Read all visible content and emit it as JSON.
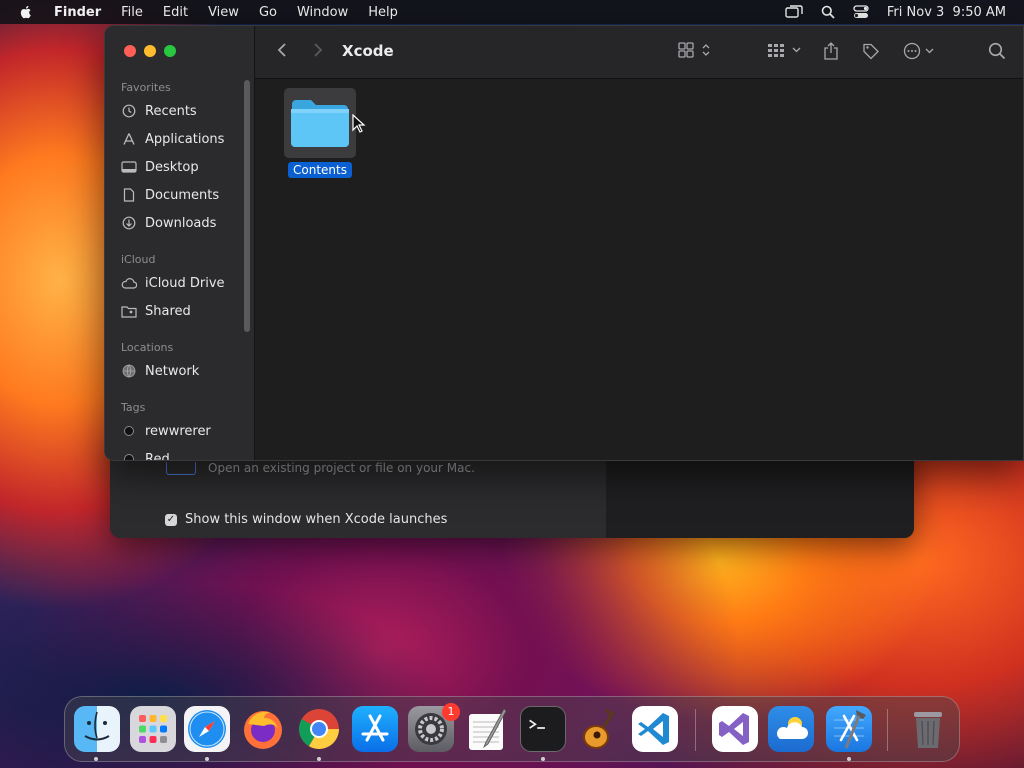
{
  "menubar": {
    "app_name": "Finder",
    "menus": [
      "File",
      "Edit",
      "View",
      "Go",
      "Window",
      "Help"
    ],
    "datetime": "Fri Nov 3  9:50 AM"
  },
  "xcode_welcome": {
    "open_text": "Open an existing project or file on your Mac.",
    "show_window_label": "Show this window when Xcode launches",
    "show_window_checked": true
  },
  "finder": {
    "title": "Xcode",
    "sidebar": {
      "favorites_header": "Favorites",
      "favorites": [
        {
          "label": "Recents",
          "icon": "clock-icon"
        },
        {
          "label": "Applications",
          "icon": "applications-icon"
        },
        {
          "label": "Desktop",
          "icon": "desktop-icon"
        },
        {
          "label": "Documents",
          "icon": "document-icon"
        },
        {
          "label": "Downloads",
          "icon": "download-icon"
        }
      ],
      "icloud_header": "iCloud",
      "icloud": [
        {
          "label": "iCloud Drive",
          "icon": "cloud-icon"
        },
        {
          "label": "Shared",
          "icon": "shared-folder-icon"
        }
      ],
      "locations_header": "Locations",
      "locations": [
        {
          "label": "Network",
          "icon": "network-icon"
        }
      ],
      "tags_header": "Tags",
      "tags": [
        {
          "label": "rewwrerer",
          "color": "#111111"
        },
        {
          "label": "Red",
          "color": "#111111"
        }
      ]
    },
    "items": [
      {
        "label": "Contents",
        "icon": "folder-icon",
        "selected": true
      }
    ]
  },
  "dock": {
    "apps": [
      {
        "name": "Finder",
        "icon": "finder-icon"
      },
      {
        "name": "Launchpad",
        "icon": "launchpad-icon"
      },
      {
        "name": "Safari",
        "icon": "safari-icon"
      },
      {
        "name": "Firefox",
        "icon": "firefox-icon"
      },
      {
        "name": "Chrome",
        "icon": "chrome-icon"
      },
      {
        "name": "App Store",
        "icon": "app-store-icon"
      },
      {
        "name": "System Settings",
        "icon": "settings-icon",
        "badge": "1"
      },
      {
        "name": "TextEdit",
        "icon": "textedit-icon"
      },
      {
        "name": "Terminal",
        "icon": "terminal-icon"
      },
      {
        "name": "GarageBand",
        "icon": "garageband-icon"
      },
      {
        "name": "Visual Studio Code",
        "icon": "vscode-icon"
      },
      {
        "name": "Visual Studio",
        "icon": "visual-studio-icon"
      },
      {
        "name": "Weather",
        "icon": "weather-icon"
      },
      {
        "name": "Xcode",
        "icon": "xcode-icon"
      },
      {
        "name": "Trash",
        "icon": "trash-icon"
      }
    ]
  }
}
